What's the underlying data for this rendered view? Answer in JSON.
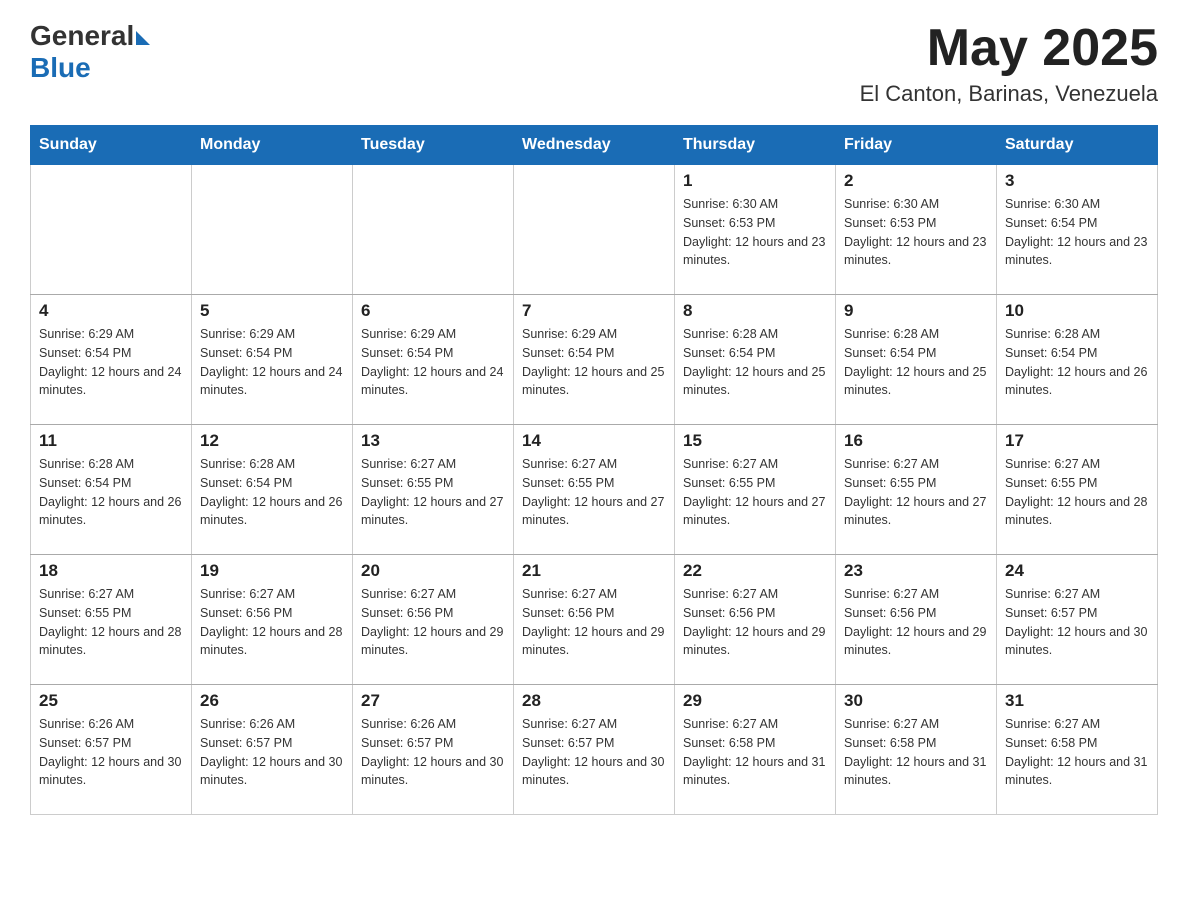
{
  "header": {
    "logo_general": "General",
    "logo_blue": "Blue",
    "month_year": "May 2025",
    "location": "El Canton, Barinas, Venezuela"
  },
  "days_of_week": [
    "Sunday",
    "Monday",
    "Tuesday",
    "Wednesday",
    "Thursday",
    "Friday",
    "Saturday"
  ],
  "weeks": [
    [
      {
        "day": "",
        "info": ""
      },
      {
        "day": "",
        "info": ""
      },
      {
        "day": "",
        "info": ""
      },
      {
        "day": "",
        "info": ""
      },
      {
        "day": "1",
        "info": "Sunrise: 6:30 AM\nSunset: 6:53 PM\nDaylight: 12 hours and 23 minutes."
      },
      {
        "day": "2",
        "info": "Sunrise: 6:30 AM\nSunset: 6:53 PM\nDaylight: 12 hours and 23 minutes."
      },
      {
        "day": "3",
        "info": "Sunrise: 6:30 AM\nSunset: 6:54 PM\nDaylight: 12 hours and 23 minutes."
      }
    ],
    [
      {
        "day": "4",
        "info": "Sunrise: 6:29 AM\nSunset: 6:54 PM\nDaylight: 12 hours and 24 minutes."
      },
      {
        "day": "5",
        "info": "Sunrise: 6:29 AM\nSunset: 6:54 PM\nDaylight: 12 hours and 24 minutes."
      },
      {
        "day": "6",
        "info": "Sunrise: 6:29 AM\nSunset: 6:54 PM\nDaylight: 12 hours and 24 minutes."
      },
      {
        "day": "7",
        "info": "Sunrise: 6:29 AM\nSunset: 6:54 PM\nDaylight: 12 hours and 25 minutes."
      },
      {
        "day": "8",
        "info": "Sunrise: 6:28 AM\nSunset: 6:54 PM\nDaylight: 12 hours and 25 minutes."
      },
      {
        "day": "9",
        "info": "Sunrise: 6:28 AM\nSunset: 6:54 PM\nDaylight: 12 hours and 25 minutes."
      },
      {
        "day": "10",
        "info": "Sunrise: 6:28 AM\nSunset: 6:54 PM\nDaylight: 12 hours and 26 minutes."
      }
    ],
    [
      {
        "day": "11",
        "info": "Sunrise: 6:28 AM\nSunset: 6:54 PM\nDaylight: 12 hours and 26 minutes."
      },
      {
        "day": "12",
        "info": "Sunrise: 6:28 AM\nSunset: 6:54 PM\nDaylight: 12 hours and 26 minutes."
      },
      {
        "day": "13",
        "info": "Sunrise: 6:27 AM\nSunset: 6:55 PM\nDaylight: 12 hours and 27 minutes."
      },
      {
        "day": "14",
        "info": "Sunrise: 6:27 AM\nSunset: 6:55 PM\nDaylight: 12 hours and 27 minutes."
      },
      {
        "day": "15",
        "info": "Sunrise: 6:27 AM\nSunset: 6:55 PM\nDaylight: 12 hours and 27 minutes."
      },
      {
        "day": "16",
        "info": "Sunrise: 6:27 AM\nSunset: 6:55 PM\nDaylight: 12 hours and 27 minutes."
      },
      {
        "day": "17",
        "info": "Sunrise: 6:27 AM\nSunset: 6:55 PM\nDaylight: 12 hours and 28 minutes."
      }
    ],
    [
      {
        "day": "18",
        "info": "Sunrise: 6:27 AM\nSunset: 6:55 PM\nDaylight: 12 hours and 28 minutes."
      },
      {
        "day": "19",
        "info": "Sunrise: 6:27 AM\nSunset: 6:56 PM\nDaylight: 12 hours and 28 minutes."
      },
      {
        "day": "20",
        "info": "Sunrise: 6:27 AM\nSunset: 6:56 PM\nDaylight: 12 hours and 29 minutes."
      },
      {
        "day": "21",
        "info": "Sunrise: 6:27 AM\nSunset: 6:56 PM\nDaylight: 12 hours and 29 minutes."
      },
      {
        "day": "22",
        "info": "Sunrise: 6:27 AM\nSunset: 6:56 PM\nDaylight: 12 hours and 29 minutes."
      },
      {
        "day": "23",
        "info": "Sunrise: 6:27 AM\nSunset: 6:56 PM\nDaylight: 12 hours and 29 minutes."
      },
      {
        "day": "24",
        "info": "Sunrise: 6:27 AM\nSunset: 6:57 PM\nDaylight: 12 hours and 30 minutes."
      }
    ],
    [
      {
        "day": "25",
        "info": "Sunrise: 6:26 AM\nSunset: 6:57 PM\nDaylight: 12 hours and 30 minutes."
      },
      {
        "day": "26",
        "info": "Sunrise: 6:26 AM\nSunset: 6:57 PM\nDaylight: 12 hours and 30 minutes."
      },
      {
        "day": "27",
        "info": "Sunrise: 6:26 AM\nSunset: 6:57 PM\nDaylight: 12 hours and 30 minutes."
      },
      {
        "day": "28",
        "info": "Sunrise: 6:27 AM\nSunset: 6:57 PM\nDaylight: 12 hours and 30 minutes."
      },
      {
        "day": "29",
        "info": "Sunrise: 6:27 AM\nSunset: 6:58 PM\nDaylight: 12 hours and 31 minutes."
      },
      {
        "day": "30",
        "info": "Sunrise: 6:27 AM\nSunset: 6:58 PM\nDaylight: 12 hours and 31 minutes."
      },
      {
        "day": "31",
        "info": "Sunrise: 6:27 AM\nSunset: 6:58 PM\nDaylight: 12 hours and 31 minutes."
      }
    ]
  ]
}
